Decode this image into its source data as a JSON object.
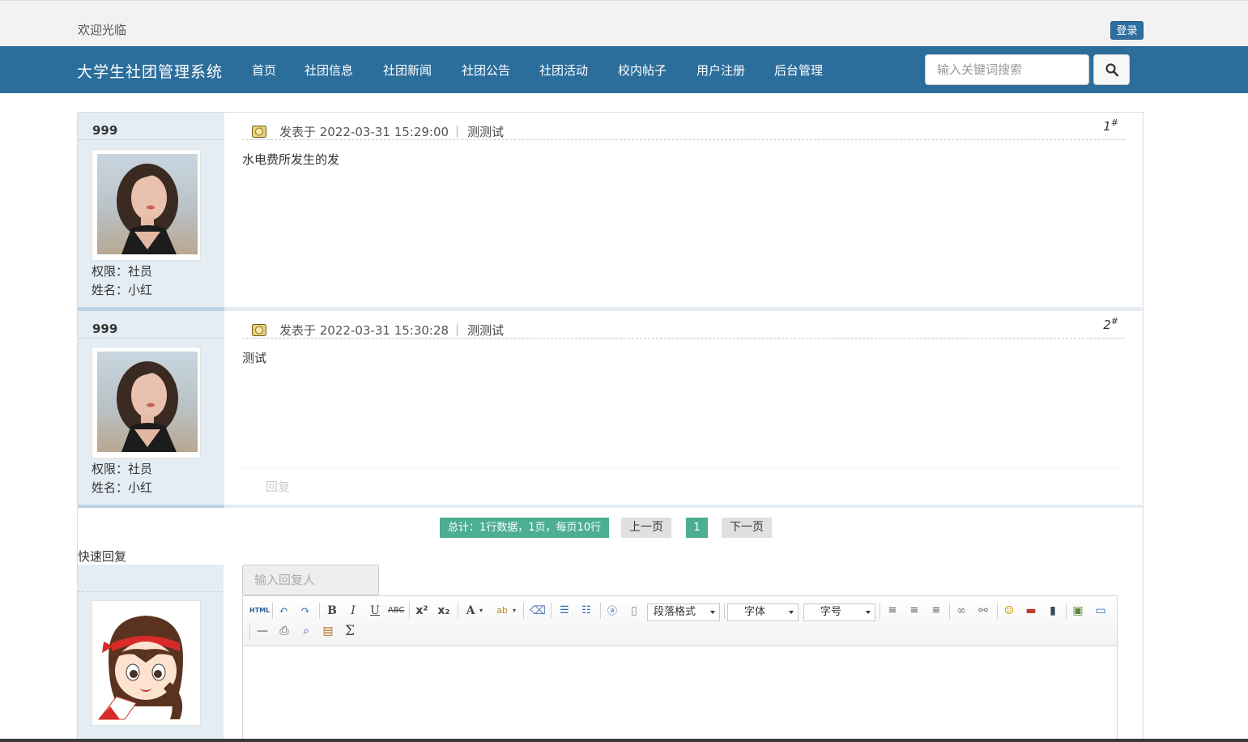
{
  "topbar": {
    "welcome": "欢迎光临",
    "login_label": "登录"
  },
  "navbar": {
    "brand": "大学生社团管理系统",
    "items": [
      "首页",
      "社团信息",
      "社团新闻",
      "社团公告",
      "社团活动",
      "校内帖子",
      "用户注册",
      "后台管理"
    ],
    "search_placeholder": "输入关键词搜索",
    "search_icon": "search-icon"
  },
  "posts": [
    {
      "username": "999",
      "role_line": "权限：社员",
      "name_line": "姓名：小红",
      "posted_label": "发表于 2022-03-31 15:29:00",
      "separator": "|",
      "topic": "测测试",
      "floor": "1",
      "floor_mark": "#",
      "content": "水电费所发生的发"
    },
    {
      "username": "999",
      "role_line": "权限：社员",
      "name_line": "姓名：小红",
      "posted_label": "发表于 2022-03-31 15:30:28",
      "separator": "|",
      "topic": "测测试",
      "floor": "2",
      "floor_mark": "#",
      "content": "测试",
      "reply_label": "回复"
    }
  ],
  "pager": {
    "total": "总计：1行数据，1页，每页10行",
    "prev": "上一页",
    "current": "1",
    "next": "下一页"
  },
  "quick_reply": {
    "title": "快速回复",
    "name_placeholder": "输入回复人"
  },
  "editor": {
    "html_label": "HTML",
    "paragraph_combo": "段落格式",
    "font_combo": "字体",
    "size_combo": "字号",
    "sigma": "Σ"
  },
  "colors": {
    "navbar": "#2c6e9b",
    "login_button": "#2c6fa0",
    "pager_active": "#4cae93",
    "sidebar": "#e5edf4"
  }
}
